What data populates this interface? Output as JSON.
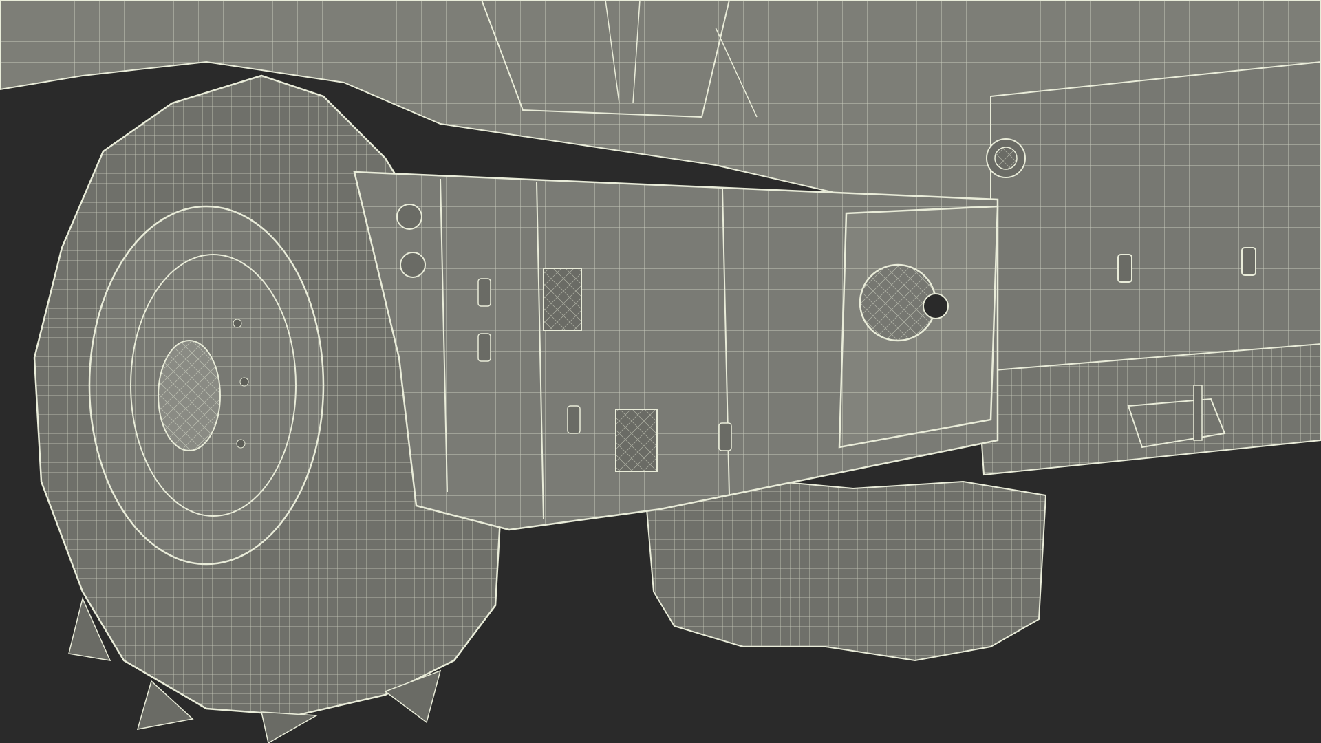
{
  "scene": {
    "subject": "wireframe-render-vehicle",
    "palette": {
      "background": "#2a2a2a",
      "body_fill": "#7d7e77",
      "body_shadow": "#6a6b65",
      "tire_fill": "#6f706a",
      "wire": "#e9ecd9"
    }
  }
}
